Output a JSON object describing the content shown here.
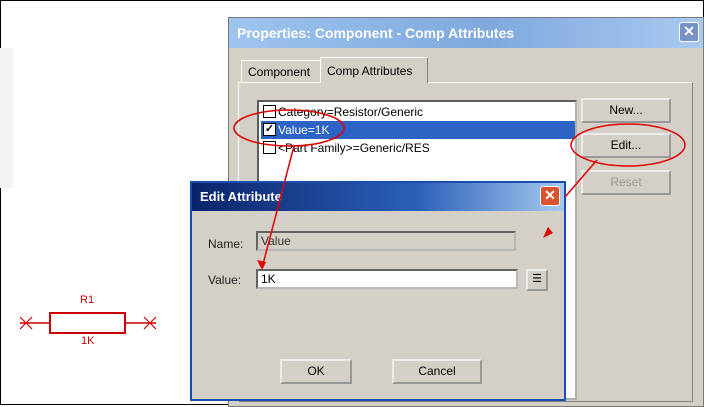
{
  "schematic": {
    "ref": "R1",
    "value": "1K"
  },
  "properties": {
    "title": "Properties: Component - Comp Attributes",
    "tabs": [
      {
        "label": "Component"
      },
      {
        "label": "Comp Attributes"
      }
    ],
    "attributes": [
      {
        "label": "Category=Resistor/Generic",
        "checked": false
      },
      {
        "label": "Value=1K",
        "checked": true
      },
      {
        "label": "<Part Family>=Generic/RES",
        "checked": false
      }
    ],
    "buttons": {
      "new": "New...",
      "edit": "Edit...",
      "reset": "Reset"
    }
  },
  "edit_dialog": {
    "title": "Edit Attribute",
    "name_label": "Name:",
    "name_value": "Value",
    "value_label": "Value:",
    "value_value": "1K",
    "ok": "OK",
    "cancel": "Cancel"
  },
  "colors": {
    "annotation": "#e00000",
    "selection": "#2e63c6"
  }
}
